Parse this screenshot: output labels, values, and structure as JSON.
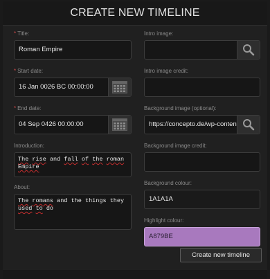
{
  "dialog": {
    "title": "CREATE NEW TIMELINE",
    "submit_label": "Create new timeline"
  },
  "left": {
    "title_label": "Title:",
    "title_value": "Roman Empire",
    "start_label": "Start date:",
    "start_value": "16 Jan 0026 BC 00:00:00",
    "end_label": "End date:",
    "end_value": "04 Sep 0426 00:00:00",
    "intro_label": "Introduction:",
    "intro_words": [
      "The",
      "rise",
      "and",
      "fall",
      "of",
      "the",
      "roman",
      "Empire"
    ],
    "about_label": "About:",
    "about_words": [
      "The",
      "romans",
      "and",
      "the",
      "things",
      "they",
      "used",
      "to",
      "do"
    ]
  },
  "right": {
    "intro_image_label": "Intro image:",
    "intro_image_value": "",
    "intro_credit_label": "Intro image credit:",
    "intro_credit_value": "",
    "bg_image_label": "Background image (optional):",
    "bg_image_value": "https://concepto.de/wp-content/up",
    "bg_credit_label": "Background image credit:",
    "bg_credit_value": "",
    "bg_colour_label": "Background colour:",
    "bg_colour_value": "1A1A1A",
    "highlight_label": "Highlight colour:",
    "highlight_value": "A879BE"
  },
  "colors": {
    "background": "#1A1A1A",
    "highlight": "#A879BE",
    "required_marker": "#D44A4A"
  },
  "icons": {
    "search": "magnifier",
    "calendar": "grid-calendar"
  },
  "required_marker": "*"
}
